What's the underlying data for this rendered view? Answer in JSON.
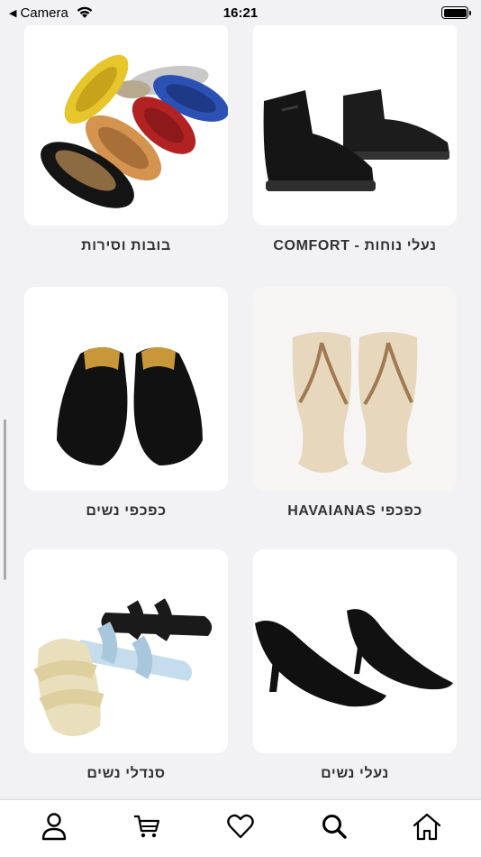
{
  "status_bar": {
    "back_app": "Camera",
    "time": "16:21"
  },
  "categories": [
    {
      "label": "בובות וסירות",
      "image": "ballet-flats-assorted-colors"
    },
    {
      "label": "נעלי נוחות - COMFORT",
      "image": "black-leather-ankle-boots"
    },
    {
      "label": "כפכפי נשים",
      "image": "black-leather-mules"
    },
    {
      "label": "כפכפי HAVAIANAS",
      "image": "beige-flip-flops"
    },
    {
      "label": "סנדלי נשים",
      "image": "strap-slide-sandals"
    },
    {
      "label": "נעלי נשים",
      "image": "black-pointed-heels"
    }
  ],
  "tabbar": {
    "items": [
      "profile-icon",
      "cart-icon",
      "heart-icon",
      "search-icon",
      "home-icon"
    ],
    "active": "search-icon"
  }
}
